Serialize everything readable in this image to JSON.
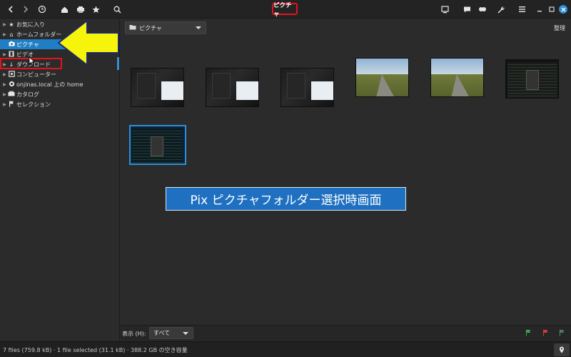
{
  "window": {
    "title": "ピクチャ"
  },
  "header": {
    "icons": [
      "back-icon",
      "forward-icon",
      "history-icon",
      "home-icon",
      "printer-icon",
      "star-icon",
      "search-icon",
      "screen-icon",
      "chat-icon",
      "link-icon",
      "wrench-icon",
      "menu-icon",
      "minimize-icon",
      "maximize-icon",
      "close-icon"
    ],
    "accent": "#e2141c"
  },
  "sidebar": {
    "items": [
      {
        "label": "お気に入り",
        "icon": "star-icon"
      },
      {
        "label": "ホームフォルダー",
        "icon": "home-icon"
      },
      {
        "label": "ピクチャ",
        "icon": "camera-icon",
        "selected": true
      },
      {
        "label": "ビデオ",
        "icon": "film-icon"
      },
      {
        "label": "ダウンロード",
        "icon": "download-icon"
      },
      {
        "label": "コンピューター",
        "icon": "computer-icon"
      },
      {
        "label": "onjinas.local 上の home",
        "icon": "network-icon"
      },
      {
        "label": "カタログ",
        "icon": "catalog-icon"
      },
      {
        "label": "セレクション",
        "icon": "flag-icon"
      }
    ],
    "selected_color": "#1f7ec4"
  },
  "toolbar": {
    "folder_value": "ピクチャ",
    "organize_label": "整理"
  },
  "thumbnails": [
    {
      "kind": "screenshot-dark"
    },
    {
      "kind": "screenshot-dark"
    },
    {
      "kind": "screenshot-dark"
    },
    {
      "kind": "road-photo"
    },
    {
      "kind": "road-photo"
    },
    {
      "kind": "terminal"
    },
    {
      "kind": "terminal",
      "selected": true
    }
  ],
  "caption": {
    "text": "Pix ピクチャフォルダー選択時画面",
    "color": "#1f70c1"
  },
  "viewbar": {
    "label": "表示 (H):",
    "value": "すべて",
    "flags": [
      "flag-green-icon",
      "flag-red-icon",
      "flag-grey-icon"
    ]
  },
  "statusbar": {
    "text": "7 files (759.8 kB)  ·  1 file selected (31.1 kB)  ·  388.2 GB の空き容量"
  }
}
